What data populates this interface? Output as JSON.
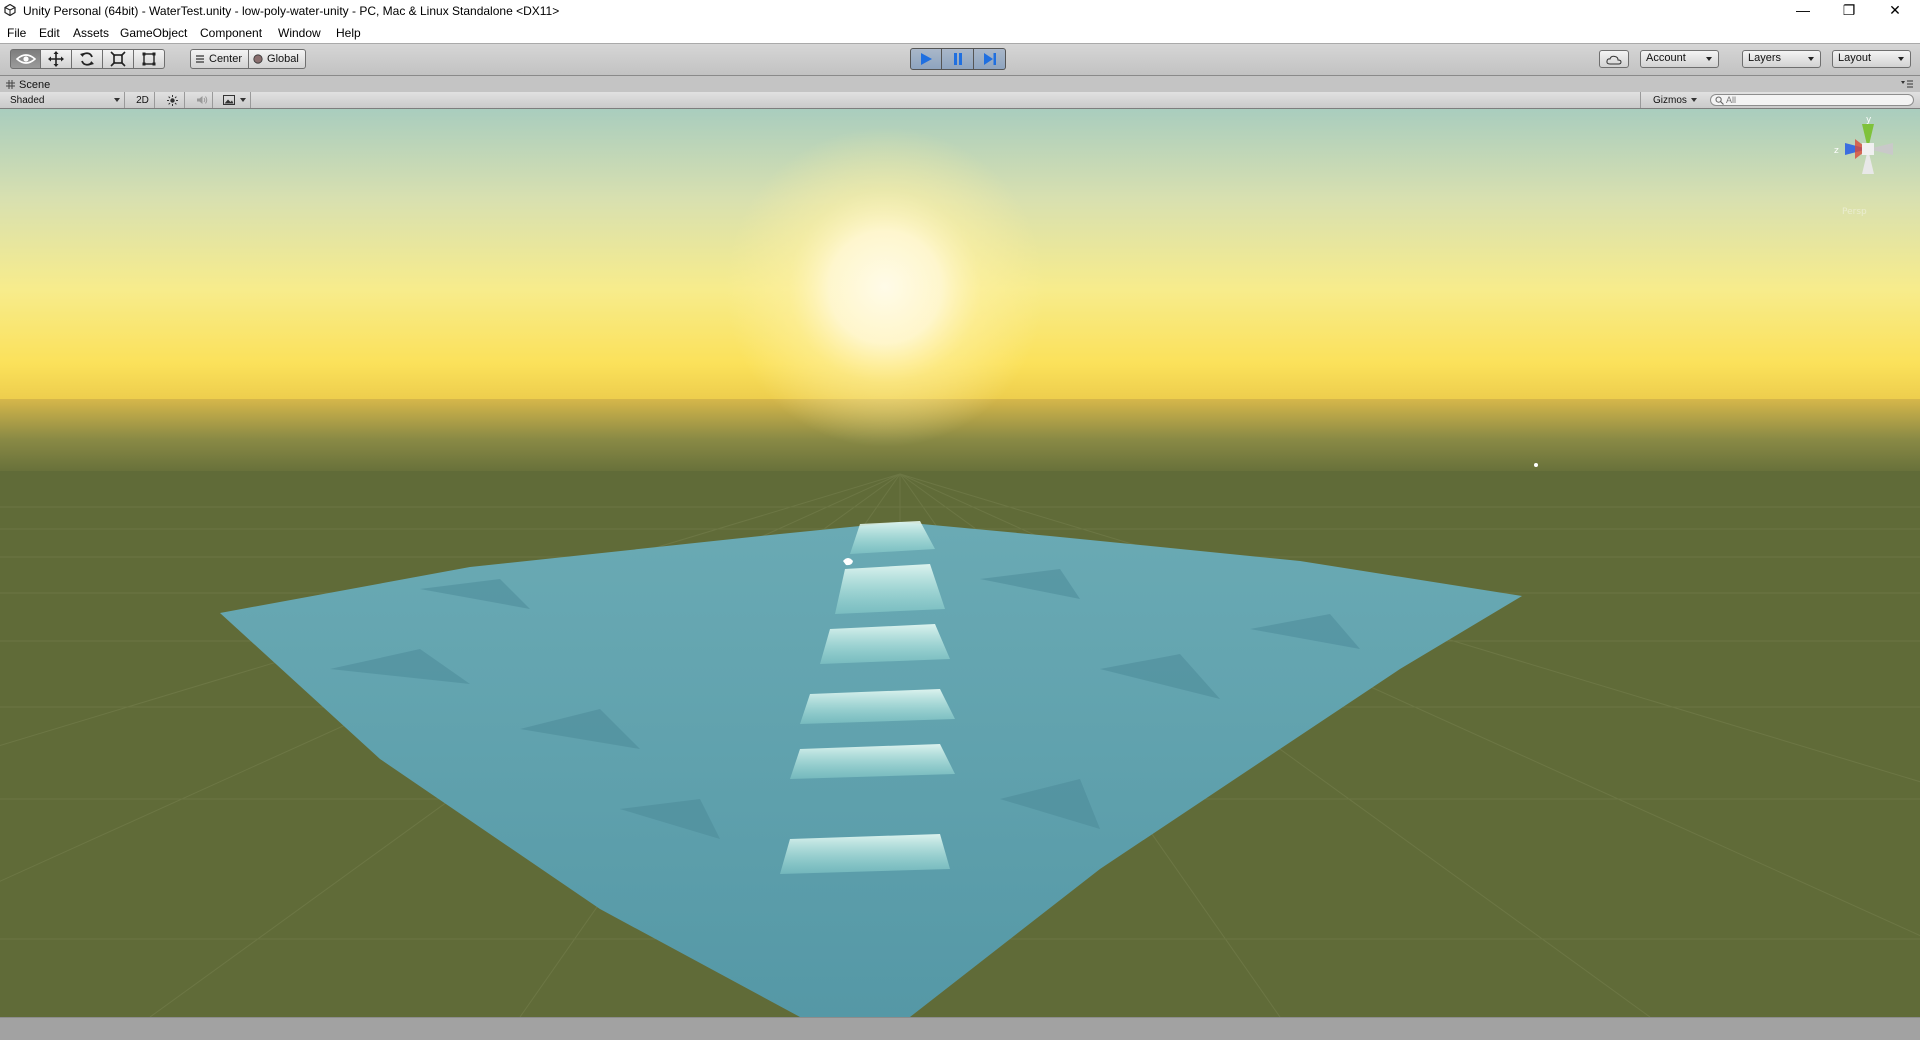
{
  "window": {
    "title": "Unity Personal (64bit) - WaterTest.unity - low-poly-water-unity - PC, Mac & Linux Standalone <DX11>",
    "minimize_glyph": "—",
    "maximize_glyph": "❐",
    "close_glyph": "✕"
  },
  "menu": {
    "items": [
      {
        "label": "File"
      },
      {
        "label": "Edit"
      },
      {
        "label": "Assets"
      },
      {
        "label": "GameObject"
      },
      {
        "label": "Component"
      },
      {
        "label": "Window"
      },
      {
        "label": "Help"
      }
    ]
  },
  "toolbar": {
    "tools": [
      {
        "icon": "hand-view-icon",
        "active": true
      },
      {
        "icon": "move-icon",
        "active": false
      },
      {
        "icon": "rotate-icon",
        "active": false
      },
      {
        "icon": "scale-icon",
        "active": false
      },
      {
        "icon": "rect-icon",
        "active": false
      }
    ],
    "pivot_label": "Center",
    "rotation_label": "Global",
    "play_state": "playing",
    "account_label": "Account",
    "layers_label": "Layers",
    "layout_label": "Layout"
  },
  "scene": {
    "tab_label": "Scene",
    "shading_mode": "Shaded",
    "mode_2d_label": "2D",
    "gizmos_label": "Gizmos",
    "search_placeholder": "All",
    "gizmo_axis_y": "y",
    "gizmo_axis_z": "z",
    "gizmo_projection": "Persp"
  },
  "colors": {
    "water": "#5aa0ac",
    "ground": "#606b38",
    "sun": "#fff7d0",
    "play_accent": "#1f6fe0"
  }
}
